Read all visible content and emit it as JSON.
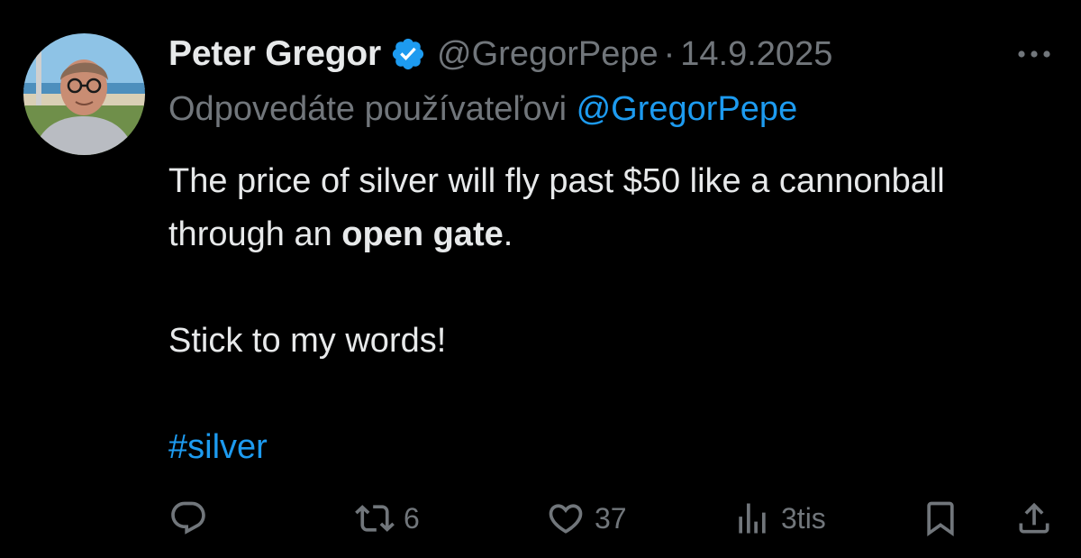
{
  "author": {
    "display_name": "Peter Gregor",
    "handle": "@GregorPepe",
    "separator": "·",
    "date": "14.9.2025",
    "verified": true,
    "avatar_icon": "profile-photo"
  },
  "reply": {
    "prefix": "Odpovedáte používateľovi",
    "mention": "@GregorPepe"
  },
  "body": {
    "line1_pre": "The price of silver will fly past $50 like a cannonball through an ",
    "line1_bold": "open gate",
    "line1_post": ".",
    "line2": "Stick to my words!",
    "hashtag": "#silver"
  },
  "actions": {
    "reply": {
      "icon": "reply-icon",
      "count": ""
    },
    "repost": {
      "icon": "repost-icon",
      "count": "6"
    },
    "like": {
      "icon": "heart-icon",
      "count": "37"
    },
    "views": {
      "icon": "analytics-icon",
      "count": "3tis"
    },
    "bookmark": {
      "icon": "bookmark-icon"
    },
    "share": {
      "icon": "share-icon"
    }
  },
  "colors": {
    "background": "#000000",
    "text": "#e7e9ea",
    "secondary": "#71767b",
    "accent": "#1d9bf0"
  }
}
